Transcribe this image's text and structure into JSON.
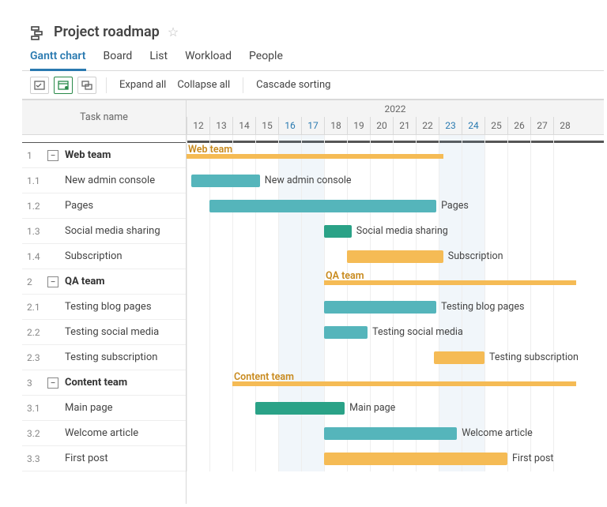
{
  "title": "Project roadmap",
  "tabs": [
    "Gantt chart",
    "Board",
    "List",
    "Workload",
    "People"
  ],
  "active_tab": 0,
  "toolbar": {
    "expand": "Expand all",
    "collapse": "Collapse all",
    "cascade": "Cascade sorting"
  },
  "left_header": "Task name",
  "timeline": {
    "year": "2022",
    "days": [
      12,
      13,
      14,
      15,
      16,
      17,
      18,
      19,
      20,
      21,
      22,
      23,
      24,
      25,
      26,
      27,
      28
    ],
    "weekend_idx": [
      4,
      5,
      11,
      12
    ]
  },
  "rows": [
    {
      "num": "1",
      "type": "group",
      "name": "Web team",
      "start": 12,
      "end": 23.2,
      "label": "Web team"
    },
    {
      "num": "1.1",
      "type": "task",
      "name": "New admin console",
      "start": 12.2,
      "end": 15.2,
      "color": "teal",
      "label": "New admin console"
    },
    {
      "num": "1.2",
      "type": "task",
      "name": "Pages",
      "start": 13.0,
      "end": 22.9,
      "color": "teal",
      "label": "Pages"
    },
    {
      "num": "1.3",
      "type": "task",
      "name": "Social media sharing",
      "start": 18.0,
      "end": 19.2,
      "color": "teal2",
      "label": "Social media sharing"
    },
    {
      "num": "1.4",
      "type": "task",
      "name": "Subscription",
      "start": 19.0,
      "end": 23.2,
      "color": "orange",
      "label": "Subscription"
    },
    {
      "num": "2",
      "type": "group",
      "name": "QA team",
      "start": 18.0,
      "end": 29.0,
      "label": "QA team"
    },
    {
      "num": "2.1",
      "type": "task",
      "name": "Testing blog pages",
      "start": 18.0,
      "end": 22.9,
      "color": "teal",
      "label": "Testing blog pages"
    },
    {
      "num": "2.2",
      "type": "task",
      "name": "Testing social media",
      "start": 18.0,
      "end": 19.9,
      "color": "teal",
      "label": "Testing social media"
    },
    {
      "num": "2.3",
      "type": "task",
      "name": "Testing subscription",
      "start": 22.8,
      "end": 25.0,
      "color": "orange",
      "label": "Testing subscription"
    },
    {
      "num": "3",
      "type": "group",
      "name": "Content team",
      "start": 14.0,
      "end": 29.0,
      "label": "Content team"
    },
    {
      "num": "3.1",
      "type": "task",
      "name": "Main page",
      "start": 15.0,
      "end": 18.9,
      "color": "teal2",
      "label": "Main page"
    },
    {
      "num": "3.2",
      "type": "task",
      "name": "Welcome article",
      "start": 18.0,
      "end": 23.8,
      "color": "teal",
      "label": "Welcome article"
    },
    {
      "num": "3.3",
      "type": "task",
      "name": "First post",
      "start": 18.0,
      "end": 26.0,
      "color": "orange",
      "label": "First post"
    }
  ],
  "chart_data": {
    "type": "gantt",
    "title": "Project roadmap",
    "x_unit": "day",
    "x_range": [
      12,
      28
    ],
    "year": 2022,
    "groups": [
      {
        "name": "Web team",
        "start": 12,
        "end": 23.2,
        "tasks": [
          {
            "name": "New admin console",
            "start": 12.2,
            "end": 15.2,
            "color": "#55b5bb"
          },
          {
            "name": "Pages",
            "start": 13.0,
            "end": 22.9,
            "color": "#55b5bb"
          },
          {
            "name": "Social media sharing",
            "start": 18.0,
            "end": 19.2,
            "color": "#2aa287"
          },
          {
            "name": "Subscription",
            "start": 19.0,
            "end": 23.2,
            "color": "#f5bb55"
          }
        ]
      },
      {
        "name": "QA team",
        "start": 18.0,
        "end": 29.0,
        "tasks": [
          {
            "name": "Testing blog pages",
            "start": 18.0,
            "end": 22.9,
            "color": "#55b5bb"
          },
          {
            "name": "Testing social media",
            "start": 18.0,
            "end": 19.9,
            "color": "#55b5bb"
          },
          {
            "name": "Testing subscription",
            "start": 22.8,
            "end": 25.0,
            "color": "#f5bb55"
          }
        ]
      },
      {
        "name": "Content team",
        "start": 14.0,
        "end": 29.0,
        "tasks": [
          {
            "name": "Main page",
            "start": 15.0,
            "end": 18.9,
            "color": "#2aa287"
          },
          {
            "name": "Welcome article",
            "start": 18.0,
            "end": 23.8,
            "color": "#55b5bb"
          },
          {
            "name": "First post",
            "start": 18.0,
            "end": 26.0,
            "color": "#f5bb55"
          }
        ]
      }
    ]
  }
}
